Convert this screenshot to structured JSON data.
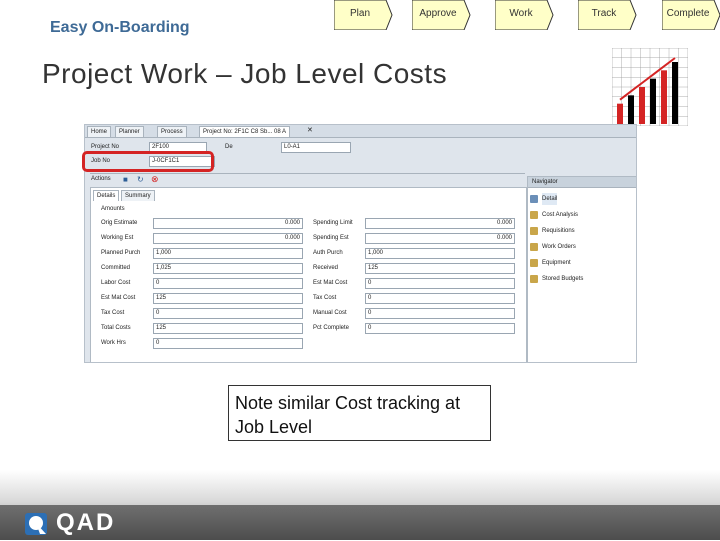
{
  "brand": "Easy On-Boarding",
  "title": "Project Work – Job Level Costs",
  "steps": [
    "Plan",
    "Approve",
    "Work",
    "Track",
    "Complete"
  ],
  "colors": {
    "step_yellow": "#ffffc8",
    "step_border": "#333333",
    "highlight": "#d42424",
    "brand": "#3e6a96"
  },
  "app": {
    "tabs": [
      "Home",
      "Planner",
      "Process",
      "Project No: 2F1C C8 Sb... 08 A"
    ],
    "project_no_label": "Project No",
    "project_no_value": "2F100",
    "job_no_label": "Job No",
    "job_no_value": "J-0CF1C1",
    "desc_label": "De",
    "desc_value": "L0-A1",
    "toolbar_label": "Actions",
    "detail_tabs": [
      "Details",
      "Summary"
    ],
    "section_label": "Amounts",
    "left_fields": [
      {
        "label": "Orig Estimate",
        "value": "0.000"
      },
      {
        "label": "Working Est",
        "value": "0.000"
      },
      {
        "label": "Planned Purch",
        "value": "1,000"
      },
      {
        "label": "Committed",
        "value": "1,025"
      },
      {
        "label": "Labor Cost",
        "value": "0"
      },
      {
        "label": "Est Mat Cost",
        "value": "125"
      },
      {
        "label": "Tax Cost",
        "value": "0"
      },
      {
        "label": "Total Costs",
        "value": "125"
      },
      {
        "label": "Work Hrs",
        "value": "0"
      }
    ],
    "right_fields": [
      {
        "label": "Spending Limit",
        "value": "0.000"
      },
      {
        "label": "Spending Est",
        "value": "0.000"
      },
      {
        "label": "Auth Purch",
        "value": "1,000"
      },
      {
        "label": "Received",
        "value": "125"
      },
      {
        "label": "Est Mat Cost",
        "value": "0"
      },
      {
        "label": "Tax Cost",
        "value": "0"
      },
      {
        "label": "Manual Cost",
        "value": "0"
      },
      {
        "label": "Pct Complete",
        "value": "0"
      }
    ],
    "side_header": "Navigator",
    "side_items": [
      "Detail",
      "Cost Analysis",
      "Requisitions",
      "Work Orders",
      "Equipment",
      "Stored Budgets"
    ]
  },
  "note": "Note similar Cost tracking at Job Level",
  "logo": "QAD",
  "chart_data": {
    "type": "bar",
    "values": [
      1,
      2,
      3,
      4,
      5,
      6
    ],
    "series_colors": [
      "#d42424",
      "#000000"
    ]
  }
}
